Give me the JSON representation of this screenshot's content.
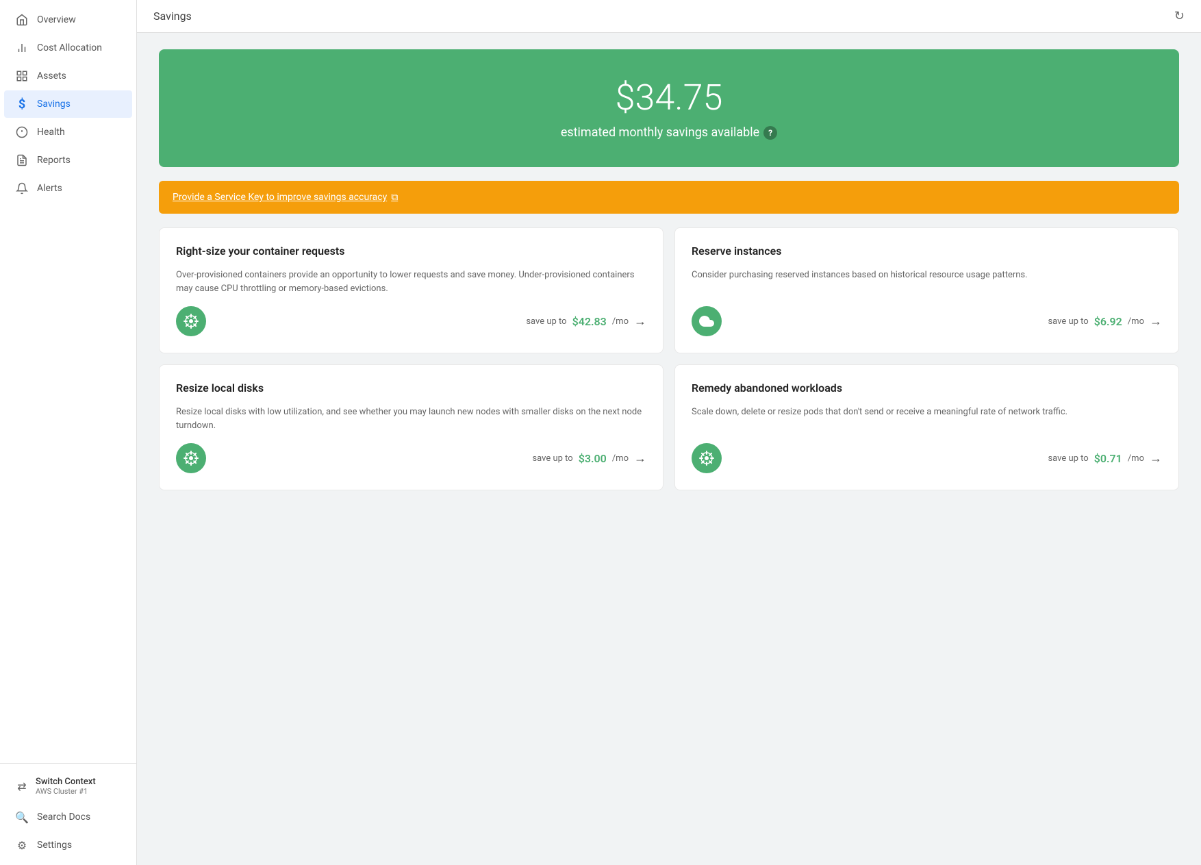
{
  "sidebar": {
    "items": [
      {
        "id": "overview",
        "label": "Overview",
        "icon": "🏠",
        "active": false
      },
      {
        "id": "cost-allocation",
        "label": "Cost Allocation",
        "icon": "📊",
        "active": false
      },
      {
        "id": "assets",
        "label": "Assets",
        "icon": "⊞",
        "active": false
      },
      {
        "id": "savings",
        "label": "Savings",
        "icon": "$",
        "active": true
      },
      {
        "id": "health",
        "label": "Health",
        "icon": "⚠",
        "active": false
      },
      {
        "id": "reports",
        "label": "Reports",
        "icon": "📋",
        "active": false
      },
      {
        "id": "alerts",
        "label": "Alerts",
        "icon": "🔔",
        "active": false
      }
    ],
    "bottom": {
      "switch_context_label": "Switch Context",
      "switch_context_sub": "AWS Cluster #1",
      "search_docs_label": "Search Docs",
      "settings_label": "Settings"
    }
  },
  "header": {
    "title": "Savings",
    "refresh_icon": "↻"
  },
  "hero": {
    "amount": "$34.75",
    "subtitle": "estimated monthly savings available",
    "info_label": "?"
  },
  "warning": {
    "text": "Provide a Service Key to improve savings accuracy",
    "external_icon": "⧉"
  },
  "cards": [
    {
      "id": "right-size",
      "title": "Right-size your container requests",
      "desc": "Over-provisioned containers provide an opportunity to lower requests and save money. Under-provisioned containers may cause CPU throttling or memory-based evictions.",
      "icon_type": "helm",
      "save_prefix": "save up to",
      "save_amount": "$42.83",
      "save_unit": "/mo"
    },
    {
      "id": "reserve-instances",
      "title": "Reserve instances",
      "desc": "Consider purchasing reserved instances based on historical resource usage patterns.",
      "icon_type": "cloud",
      "save_prefix": "save up to",
      "save_amount": "$6.92",
      "save_unit": "/mo"
    },
    {
      "id": "resize-disks",
      "title": "Resize local disks",
      "desc": "Resize local disks with low utilization, and see whether you may launch new nodes with smaller disks on the next node turndown.",
      "icon_type": "helm",
      "save_prefix": "save up to",
      "save_amount": "$3.00",
      "save_unit": "/mo"
    },
    {
      "id": "remedy-workloads",
      "title": "Remedy abandoned workloads",
      "desc": "Scale down, delete or resize pods that don't send or receive a meaningful rate of network traffic.",
      "icon_type": "helm",
      "save_prefix": "save up to",
      "save_amount": "$0.71",
      "save_unit": "/mo"
    }
  ]
}
